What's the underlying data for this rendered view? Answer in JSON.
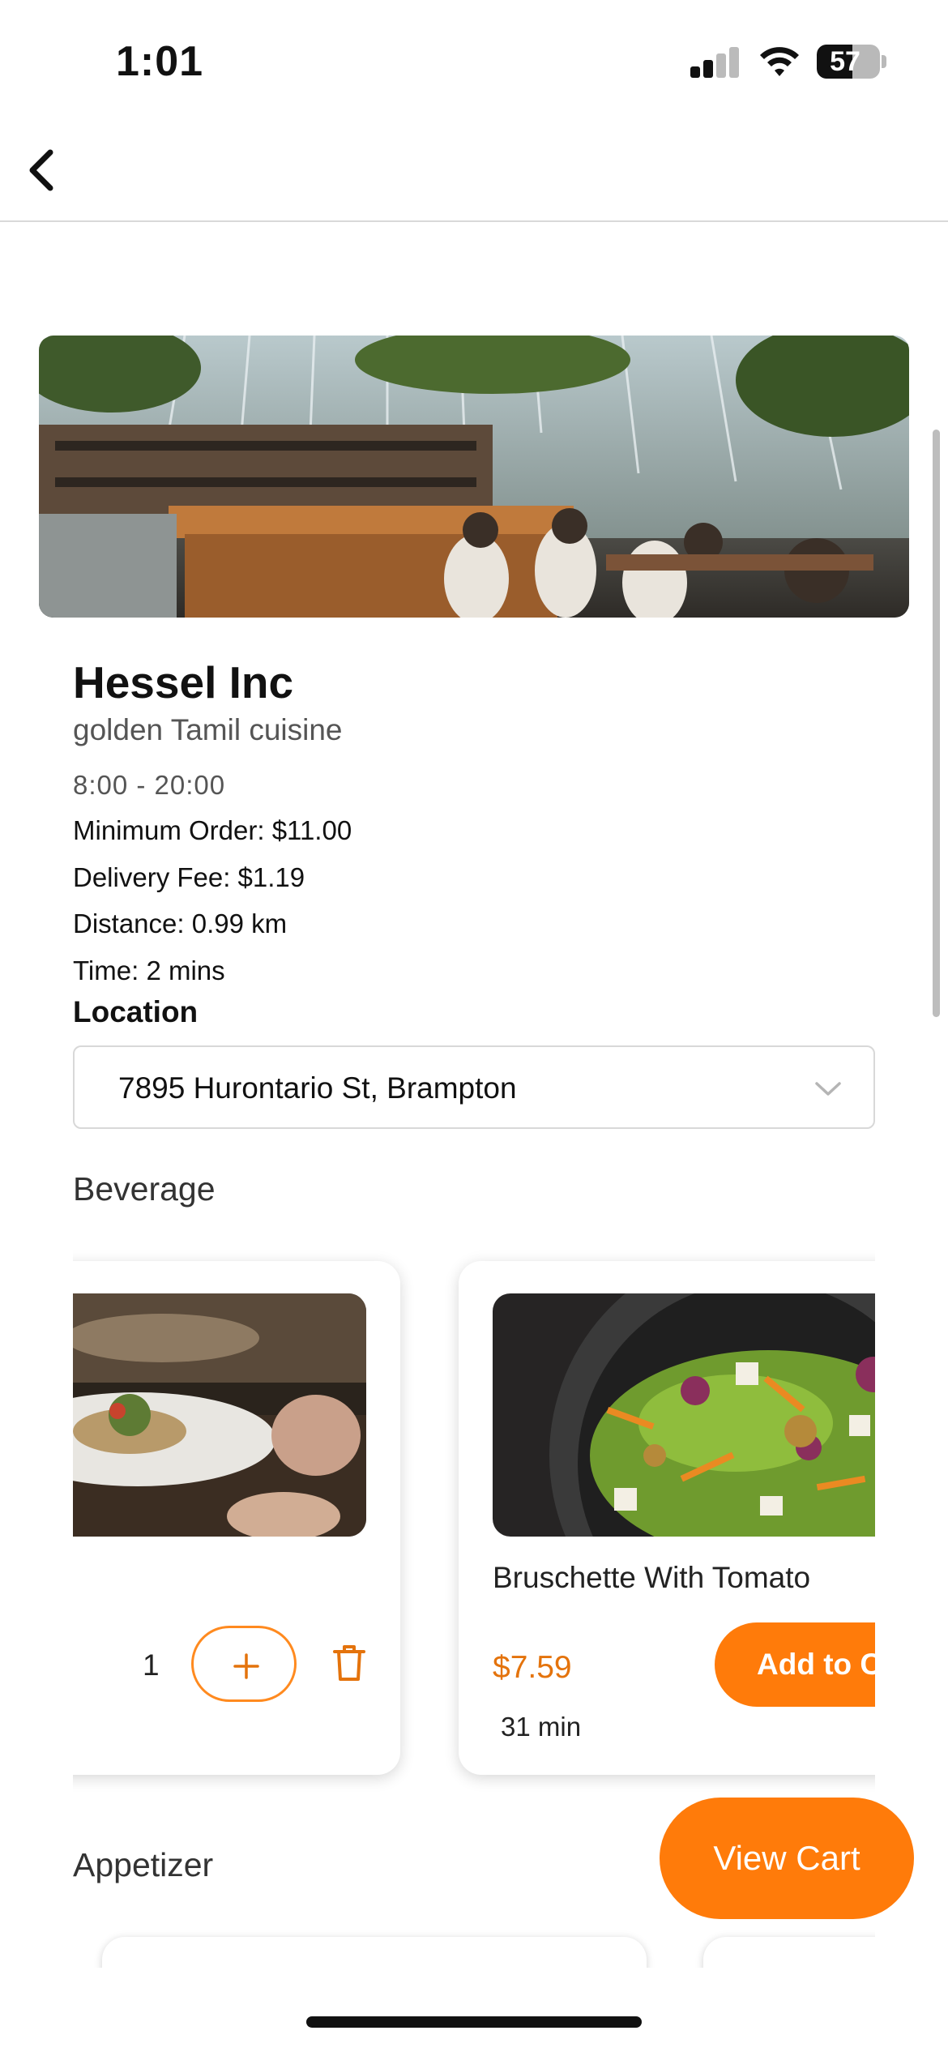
{
  "status": {
    "time": "1:01",
    "battery": "57",
    "battery_level": 0.57
  },
  "restaurant": {
    "name": "Hessel Inc",
    "cuisine": "golden Tamil cuisine",
    "hours": "8:00 - 20:00",
    "minimum_order": "Minimum Order: $11.00",
    "delivery_fee": "Delivery Fee: $1.19",
    "distance": "Distance: 0.99 km",
    "time": "Time: 2 mins"
  },
  "location": {
    "label": "Location",
    "selected": "7895 Hurontario St, Brampton"
  },
  "sections": {
    "beverage": "Beverage",
    "appetizer": "Appetizer"
  },
  "cards": {
    "in_cart": {
      "quantity": "1",
      "plus": "+"
    },
    "bruschette": {
      "name": "Bruschette With Tomato",
      "price": "$7.59",
      "time": "31 min",
      "add_label": "Add to C"
    }
  },
  "cart": {
    "view_label": "View Cart"
  },
  "colors": {
    "accent": "#ff7b0a",
    "price": "#e4730c"
  },
  "icons": {
    "back": "back-arrow-icon",
    "chevron": "chevron-down-icon",
    "trash": "trash-icon",
    "signal": "signal-icon",
    "wifi": "wifi-icon",
    "battery": "battery-icon"
  }
}
